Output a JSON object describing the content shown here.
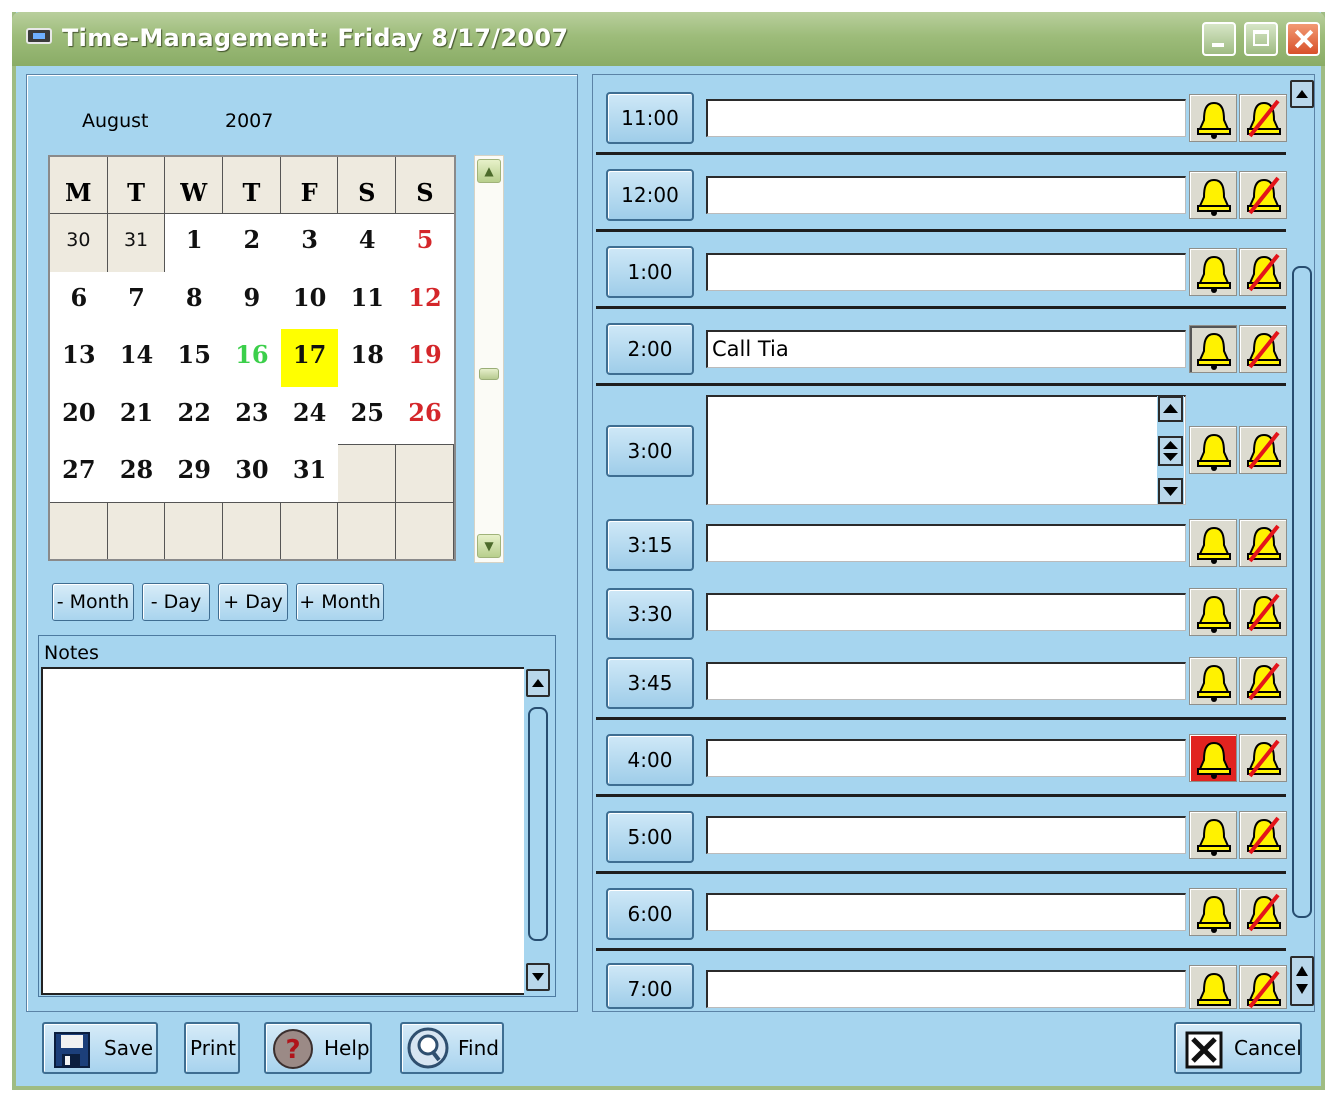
{
  "window": {
    "title": "Time-Management: Friday 8/17/2007"
  },
  "calendar": {
    "month": "August",
    "year": "2007",
    "weekday_headers": [
      "M",
      "T",
      "W",
      "T",
      "F",
      "S",
      "S"
    ],
    "weeks": [
      [
        "30",
        "31",
        "1",
        "2",
        "3",
        "4",
        "5"
      ],
      [
        "6",
        "7",
        "8",
        "9",
        "10",
        "11",
        "12"
      ],
      [
        "13",
        "14",
        "15",
        "16",
        "17",
        "18",
        "19"
      ],
      [
        "20",
        "21",
        "22",
        "23",
        "24",
        "25",
        "26"
      ],
      [
        "27",
        "28",
        "29",
        "30",
        "31",
        "",
        ""
      ],
      [
        "",
        "",
        "",
        "",
        "",
        "",
        ""
      ]
    ],
    "selected_day": "17",
    "today_day": "16",
    "colors": {
      "sunday": "#d4262a",
      "today": "#3bcf4a",
      "selected": "#ffff00"
    }
  },
  "nav_buttons": {
    "minus_month": "- Month",
    "minus_day": "- Day",
    "plus_day": "+ Day",
    "plus_month": "+ Month"
  },
  "notes": {
    "label": "Notes",
    "value": ""
  },
  "schedule": {
    "slots": [
      {
        "time": "11:00",
        "text": "",
        "alarm": "off"
      },
      {
        "time": "12:00",
        "text": "",
        "alarm": "off"
      },
      {
        "time": "1:00",
        "text": "",
        "alarm": "off"
      },
      {
        "time": "2:00",
        "text": "Call Tia",
        "alarm": "pressed"
      },
      {
        "time": "3:00",
        "text": "",
        "alarm": "off"
      },
      {
        "time": "3:15",
        "text": "",
        "alarm": "off"
      },
      {
        "time": "3:30",
        "text": "",
        "alarm": "off"
      },
      {
        "time": "3:45",
        "text": "",
        "alarm": "off"
      },
      {
        "time": "4:00",
        "text": "",
        "alarm": "active"
      },
      {
        "time": "5:00",
        "text": "",
        "alarm": "off"
      },
      {
        "time": "6:00",
        "text": "",
        "alarm": "off"
      },
      {
        "time": "7:00",
        "text": "",
        "alarm": "off"
      }
    ],
    "alarm_active_color": "#e1231f"
  },
  "footer": {
    "save": "Save",
    "print": "Print",
    "help": "Help",
    "find": "Find",
    "cancel": "Cancel"
  },
  "icons": {
    "app": "app-icon",
    "save": "floppy-disk-icon",
    "help": "question-mark-icon",
    "find": "magnifier-icon",
    "cancel": "x-box-icon",
    "alarm_on": "bell-icon",
    "alarm_off": "crossed-bell-icon"
  }
}
